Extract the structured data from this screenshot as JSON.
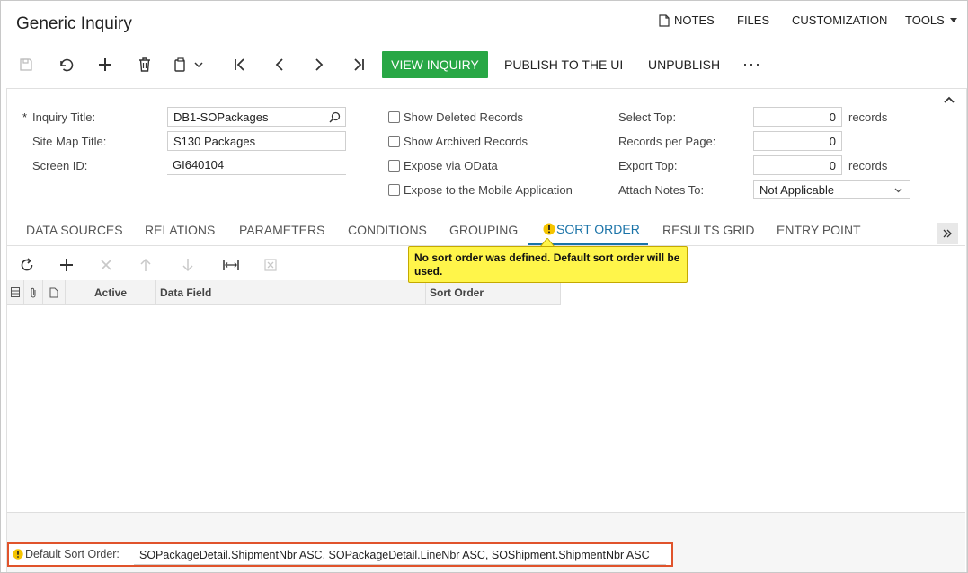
{
  "window": {
    "title": "Generic Inquiry"
  },
  "topnav": {
    "notes": "NOTES",
    "files": "FILES",
    "customization": "CUSTOMIZATION",
    "tools": "TOOLS"
  },
  "toolbar": {
    "view_inquiry": "VIEW INQUIRY",
    "publish": "PUBLISH TO THE UI",
    "unpublish": "UNPUBLISH",
    "more": "···"
  },
  "form": {
    "required_mark": "*",
    "inquiry_title_label": "Inquiry Title:",
    "inquiry_title_value": "DB1-SOPackages",
    "site_map_title_label": "Site Map Title:",
    "site_map_title_value": "S130 Packages",
    "screen_id_label": "Screen ID:",
    "screen_id_value": "GI640104",
    "show_deleted": "Show Deleted Records",
    "show_archived": "Show Archived Records",
    "expose_odata": "Expose via OData",
    "expose_mobile": "Expose to the Mobile Application",
    "select_top_label": "Select Top:",
    "select_top_value": "0",
    "select_top_unit": "records",
    "records_per_page_label": "Records per Page:",
    "records_per_page_value": "0",
    "export_top_label": "Export Top:",
    "export_top_value": "0",
    "export_top_unit": "records",
    "attach_notes_label": "Attach Notes To:",
    "attach_notes_value": "Not Applicable"
  },
  "tabs": {
    "data_sources": "DATA SOURCES",
    "relations": "RELATIONS",
    "parameters": "PARAMETERS",
    "conditions": "CONDITIONS",
    "grouping": "GROUPING",
    "sort_order": "SORT ORDER",
    "results_grid": "RESULTS GRID",
    "entry_point": "ENTRY POINT"
  },
  "grid": {
    "columns": [
      "Active",
      "Data Field",
      "Sort Order"
    ]
  },
  "tooltip": {
    "text": "No sort order was defined. Default sort order will be used."
  },
  "default_sort": {
    "label": "Default Sort Order:",
    "value": "SOPackageDetail.ShipmentNbr ASC, SOPackageDetail.LineNbr ASC, SOShipment.ShipmentNbr ASC"
  },
  "colors": {
    "accent": "#28a745",
    "tab_active": "#1a73a8",
    "warning": "#f5c400",
    "highlight_border": "#e0532b"
  }
}
